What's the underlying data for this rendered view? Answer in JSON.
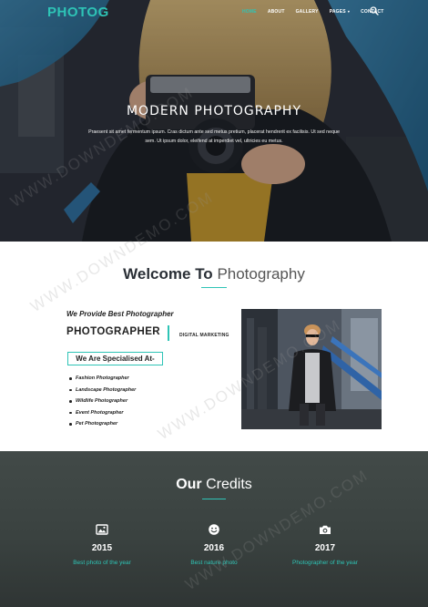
{
  "nav": {
    "brand": "PHOTOG",
    "links": [
      {
        "label": "HOME",
        "active": true
      },
      {
        "label": "ABOUT",
        "active": false
      },
      {
        "label": "GALLERY",
        "active": false
      },
      {
        "label": "PAGES",
        "active": false,
        "dropdown": true
      },
      {
        "label": "CONTACT",
        "active": false
      }
    ],
    "search_icon": "search-icon",
    "caret": "▾"
  },
  "hero": {
    "title": "MODERN PHOTOGRAPHY",
    "text": "Praesent sit amet fermentum ipsum. Cras dictum ante sed metus pretium, placerat hendrerit ex facilisis. Ut sed neque sem. Ut ipsum dolor, eleifend at imperdiet vel, ultricies eu metus."
  },
  "welcome": {
    "title_bold": "Welcome To",
    "title_light": "Photography",
    "provide": "We Provide Best Photographer",
    "photographer": "PHOTOGRAPHER",
    "digital": "DIGITAL MARKETING",
    "specialised": "We Are Specialised At-",
    "list": [
      "Fashion Photographer",
      "Landscape Photographer",
      "Wildlife Photographer",
      "Event Photographer",
      "Pet Photographer"
    ]
  },
  "credits": {
    "title_bold": "Our",
    "title_light": "Credits",
    "items": [
      {
        "icon": "image-icon",
        "year": "2015",
        "label": "Best photo of the year"
      },
      {
        "icon": "smile-icon",
        "year": "2016",
        "label": "Best nature photo"
      },
      {
        "icon": "camera-icon",
        "year": "2017",
        "label": "Photographer of the year"
      }
    ]
  },
  "watermark": "WWW.DOWNDEMO.COM",
  "colors": {
    "accent": "#2ec4b6",
    "credits_bg": "#3a4240",
    "text_dark": "#222222"
  }
}
